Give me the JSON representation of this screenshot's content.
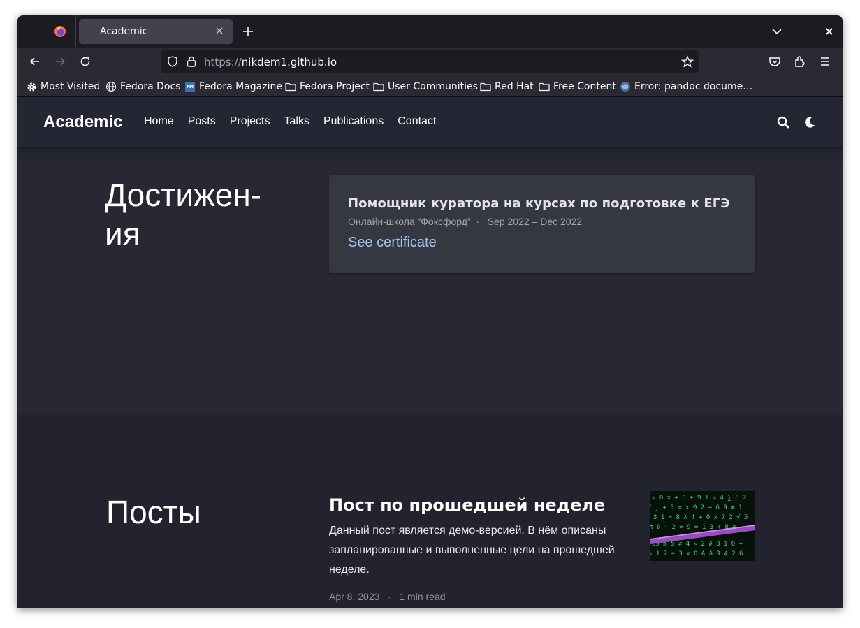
{
  "browser": {
    "tab_title": "Academic",
    "url_scheme": "https://",
    "url_host": "nikdem1.github.io",
    "bookmarks": [
      {
        "label": "Most Visited",
        "icon": "gear-icon"
      },
      {
        "label": "Fedora Docs",
        "icon": "globe-icon"
      },
      {
        "label": "Fedora Magazine",
        "icon": "fedora-magazine-icon"
      },
      {
        "label": "Fedora Project",
        "icon": "folder-icon"
      },
      {
        "label": "User Communities",
        "icon": "folder-icon"
      },
      {
        "label": "Red Hat",
        "icon": "folder-icon"
      },
      {
        "label": "Free Content",
        "icon": "folder-icon"
      },
      {
        "label": "Error: pandoc docume…",
        "icon": "pandoc-icon"
      }
    ]
  },
  "site": {
    "brand": "Academic",
    "menu": [
      "Home",
      "Posts",
      "Projects",
      "Talks",
      "Publications",
      "Contact"
    ]
  },
  "achievements": {
    "title_line1": "Достижен-",
    "title_line2": "ия",
    "card_title": "Помощник куратора на курсах по подготовке к ЕГЭ",
    "card_meta": "Онлайн-школа “Фоксфорд”  ·   Sep 2022 – Dec 2022",
    "card_link": "See certificate"
  },
  "posts": {
    "title": "Посты",
    "post_title": "Пост по прошедшей неделе",
    "post_desc": "Данный пост является демо-версией. В нём описаны запланированные и выполненные цели на прошедшей неделе.",
    "post_meta": "Apr 8, 2023   ·   1 min read"
  },
  "colors": {
    "page_bg": "#252633",
    "card_bg": "#353741",
    "link": "#9fc6f3"
  }
}
